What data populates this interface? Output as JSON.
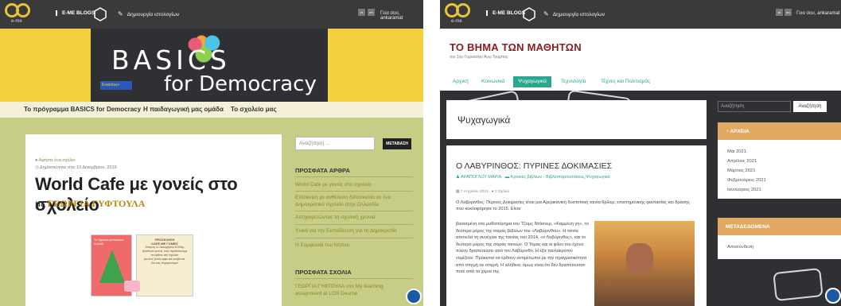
{
  "left": {
    "topbar": {
      "logo_text": "e-me",
      "blogs_label": "E-ME BLOGS",
      "create_label": "Δημιουργία ιστολογίων",
      "lang_el": "el",
      "lang_en": "en",
      "greeting": "Γεια σου, ankaramat"
    },
    "banner": {
      "title_line1": "BASICS",
      "title_line2": "for Democracy",
      "erasmus": "Erasmus+"
    },
    "nav": [
      "Το πρόγραμμα BASICS for Democracy",
      "Η παιδαγωγική μας ομάδα",
      "Το σχολείο μας"
    ],
    "post": {
      "category": "Αφήστε ένα σχόλιο",
      "date": "Δημοσιεύτηκε στις 10 Δεκεμβρίου, 2019",
      "title": "World Cafe με γονείς στο σχολείο",
      "author_prefix": "με",
      "author": "ΓΕΩΡΓΙΑ ΓΥΦΤΟΥΛΑ",
      "card_left_text": "Το Χριστουγεννιάτικο Καλάθι",
      "card_right_title": "ΠΡΟΣΚΛΗΣΗ",
      "card_right_sub": "CAFÉ ΜΕ ΓΟΝΕΙΣ",
      "card_right_lines": [
        "Τετάρτη 11 Δεκεμβρίου 8:30πμ",
        "Αγαπητοί γονείς, σας προσκαλούμε",
        "να έρθετε στο σχολείο",
        "για ένα ζεστό καφέ και κουβέντα.",
        "Θα σας περιμένουμε!"
      ]
    },
    "sidebar": {
      "search_placeholder": "Αναζήτηση ...",
      "search_button": "ΜΕΤΑΒΑΣΗ",
      "recent_posts_heading": "ΠΡΟΣΦΑΤΑ ΑΡΘΡΑ",
      "recent_posts": [
        "World Cafe με γονείς στο σχολείο",
        "Επίσκεψη με ανθέλεση διδασκαλία σε ένα Δημοκρατικό σχολείο στην Ολλανδία",
        "Αποχαιρετώντας τη σχολική χρονιά",
        "Υλικά για την Εκπαίδευση για τη Δημοκρατία",
        "Η Συμφωνία του Κήπου"
      ],
      "recent_comments_heading": "ΠΡΟΣΦΑΤΑ ΣΧΟΛΙΑ",
      "recent_comment": "ΓΕΩΡΓΙΑ ΓΥΦΤΟΥΛΑ στο My teaching assignment at LOS Deurne"
    }
  },
  "right": {
    "topbar": {
      "logo_text": "e-me",
      "blogs_label": "E-ME BLOGS",
      "create_label": "Δημιουργία ιστολογίων",
      "lang_el": "el",
      "lang_en": "en",
      "greeting": "Γεια σου, ankaramat"
    },
    "site_title": "ΤΟ ΒΗΜΑ ΤΩΝ ΜΑΘΗΤΩΝ",
    "site_subtitle": "του 1ου Γυμνασίου Άνω Τούμπας",
    "nav": [
      "Αρχική",
      "Κοινωνικά",
      "Ψυχαγωγικά",
      "Τεχνολογία",
      "Τέχνες και Πολιτισμός"
    ],
    "nav_active": 2,
    "category_title": "Ψυχαγωγικά",
    "article": {
      "title": "Ο ΛΑΒΥΡΙΝΘΟΣ: ΠΥΡΙΝΕΣ ΔΟΚΙΜΑΣΙΕΣ",
      "author": "ΑΡΑΠΟΓΛΟΥ ΜΑΡΙΑ",
      "categories": "Κριτικές βιβλίων - Βιβλιοπαρουσιάσεις,Ψυχαγωγικά",
      "date": "7 Απριλίου 2021",
      "comments": "0 Σχόλια",
      "intro": "Ο Λαβύρινθος: Πύρινες Δοκιμασίες είναι μια Αμερικανική δυστοπική ταινία θρίλερ, επιστημονικής φαντασίας και δράσης που κυκλοφόρησε το 2015. Είναι",
      "body": "βασισμένη στο μυθιστόρημα του Τζέιμς Ντάσνερ, «Καμμένη γη», το δεύτερο μέρος της σειράς βιβλίων του «Λαβύρινθου». Η ταινία αποτελεί τη συνέχεια της ταινίας του 2014, «ο Λαβύρινθος», και το δεύτερο μέρος της σειράς ταινιών. Ο Τόμας και οι φίλοι του έχουν πλέον δραπετεύσει από τον Λαβύρινθο. Η έξιτ ταυλακρότον νομίζουν. Πρόκειται να έρθουν αντιμέτωποι με την πραγματικότητα από στιγμή σε στιγμή. Η αλήθεια, όμως είναι ότι δεν δραπέτευσαν ποτέ από τα χέρια της"
    },
    "sidebar": {
      "search_placeholder": "Αναζήτηση",
      "search_button": "Αναζήτηση",
      "archive_heading": "ΑΡΧΕΙΑ",
      "archive_items": [
        "Μάι 2021",
        "Απρίλιος 2021",
        "Μάρτιος 2021",
        "Φεβρουάριος 2021",
        "Ιανουάριος 2021"
      ],
      "meta_heading": "ΜΕΤΑΔΕΔΟΜΕΝΑ",
      "meta_items": [
        "Αποσύνδεση"
      ]
    }
  },
  "colors": {
    "topbar": "#3a3a3a",
    "left_bg": "#c7cc87",
    "banner_yellow": "#f2d03f",
    "right_accent": "#2aa78f",
    "right_widget": "#e0a860"
  }
}
